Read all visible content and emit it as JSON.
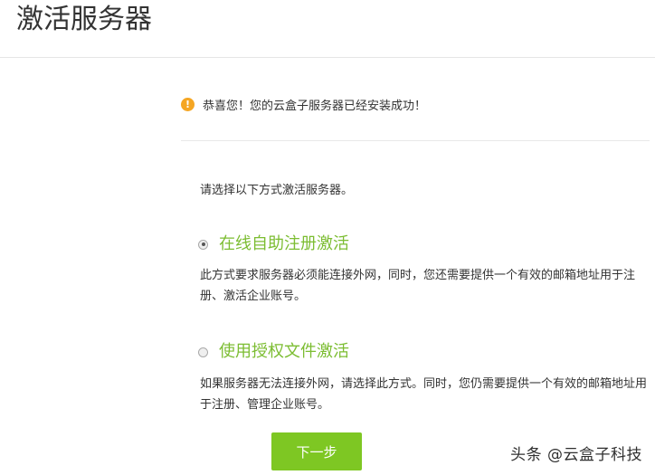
{
  "page": {
    "title": "激活服务器"
  },
  "notice": {
    "icon": "warning-icon",
    "text": "恭喜您！您的云盒子服务器已经安装成功！"
  },
  "instruction": "请选择以下方式激活服务器。",
  "options": [
    {
      "label": "在线自助注册激活",
      "selected": true,
      "description": "此方式要求服务器必须能连接外网，同时，您还需要提供一个有效的邮箱地址用于注册、激活企业账号。"
    },
    {
      "label": "使用授权文件激活",
      "selected": false,
      "description": "如果服务器无法连接外网，请选择此方式。同时，您仍需要提供一个有效的邮箱地址用于注册、管理企业账号。"
    }
  ],
  "buttons": {
    "next_label": "下一步"
  },
  "watermark": "头条 @云盒子科技",
  "colors": {
    "accent_green": "#7cbd32",
    "button_green": "#7ec723",
    "warning_orange": "#f5a623"
  }
}
